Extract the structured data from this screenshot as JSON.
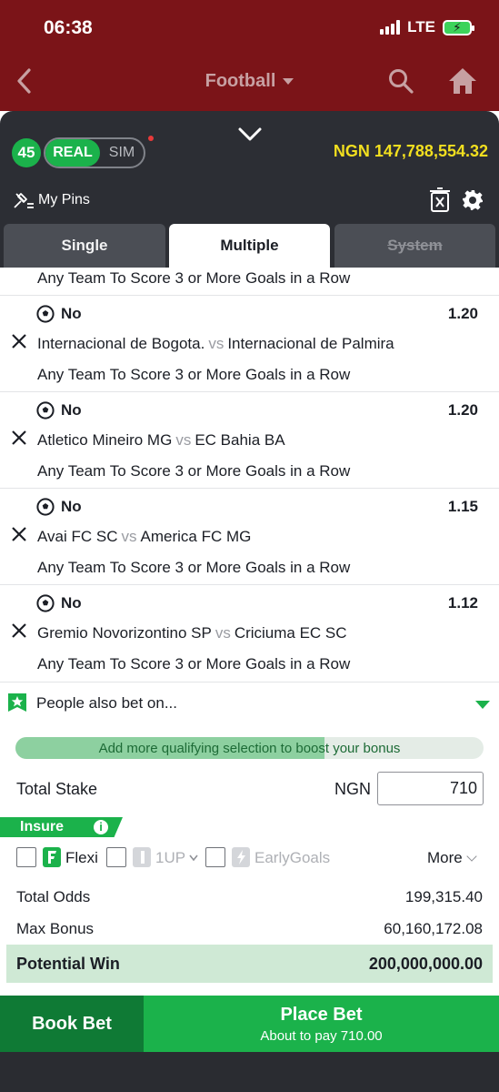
{
  "status": {
    "time": "06:38",
    "network": "LTE"
  },
  "header": {
    "title": "Football"
  },
  "betslip": {
    "count": "45",
    "mode_real": "REAL",
    "mode_sim": "SIM",
    "balance": "NGN 147,788,554.32",
    "my_pins": "My Pins",
    "tabs": {
      "single": "Single",
      "multiple": "Multiple",
      "system": "System"
    }
  },
  "partial_market": "Any Team To Score 3 or More Goals in a Row",
  "selections": [
    {
      "pick": "No",
      "odds": "1.20",
      "home": "Internacional de Bogota.",
      "vs": "vs",
      "away": "Internacional de Palmira",
      "market": "Any Team To Score 3 or More Goals in a Row"
    },
    {
      "pick": "No",
      "odds": "1.20",
      "home": "Atletico Mineiro MG",
      "vs": "vs",
      "away": "EC Bahia BA",
      "market": "Any Team To Score 3 or More Goals in a Row"
    },
    {
      "pick": "No",
      "odds": "1.15",
      "home": "Avai FC SC",
      "vs": "vs",
      "away": "America FC MG",
      "market": "Any Team To Score 3 or More Goals in a Row"
    },
    {
      "pick": "No",
      "odds": "1.12",
      "home": "Gremio Novorizontino SP",
      "vs": "vs",
      "away": "Criciuma EC SC",
      "market": "Any Team To Score 3 or More Goals in a Row"
    }
  ],
  "people_also_bet": "People also bet on...",
  "boost": {
    "text": "Add more qualifying selection to boost your bonus",
    "progress": 0.66
  },
  "stake": {
    "label": "Total Stake",
    "currency": "NGN",
    "value": "710"
  },
  "insure": {
    "label": "Insure"
  },
  "options": {
    "flexi": "Flexi",
    "oneup": "1UP",
    "early_goals": "EarlyGoals",
    "more": "More"
  },
  "totals": {
    "odds_label": "Total Odds",
    "odds_value": "199,315.40",
    "bonus_label": "Max Bonus",
    "bonus_value": "60,160,172.08",
    "win_label": "Potential Win",
    "win_value": "200,000,000.00"
  },
  "actions": {
    "book": "Book Bet",
    "place": "Place Bet",
    "pay_note": "About to pay 710.00"
  },
  "colors": {
    "header": "#7b1418",
    "dark_panel": "#2c2e34",
    "accent_green": "#1bb24b",
    "balance_yellow": "#f2df1f"
  }
}
